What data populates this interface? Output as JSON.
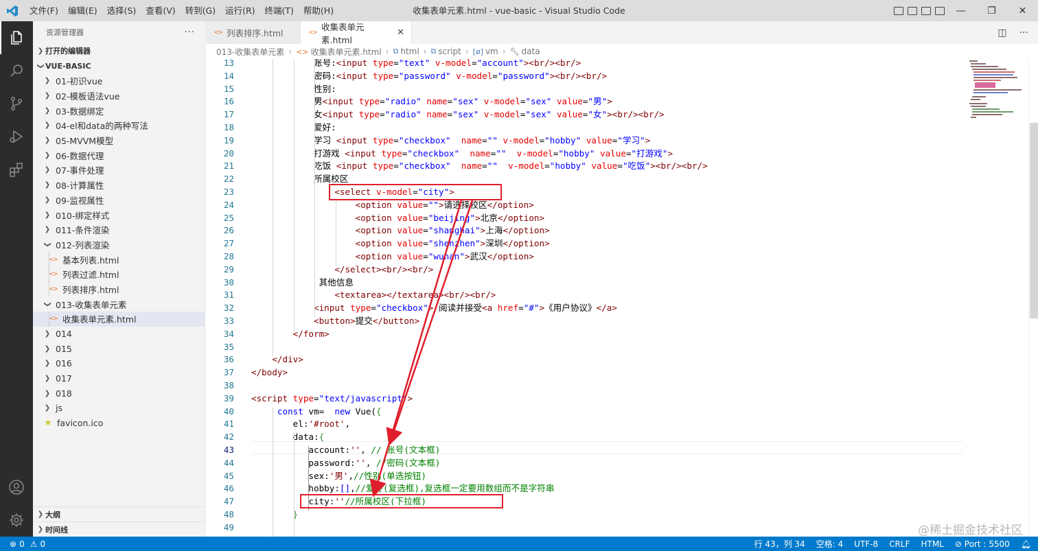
{
  "titlebar": {
    "menu": [
      "文件(F)",
      "编辑(E)",
      "选择(S)",
      "查看(V)",
      "转到(G)",
      "运行(R)",
      "终端(T)",
      "帮助(H)"
    ],
    "window_title": "收集表单元素.html - vue-basic - Visual Studio Code"
  },
  "activity": [
    "explorer-icon",
    "search-icon",
    "source-control-icon",
    "run-debug-icon",
    "extensions-icon",
    "account-icon",
    "settings-gear-icon"
  ],
  "sidebar": {
    "title": "资源管理器",
    "more": "···",
    "open_editors": "打开的编辑器",
    "project": "VUE-BASIC",
    "items": [
      {
        "label": "01-初识vue",
        "type": "folder"
      },
      {
        "label": "02-模板语法vue",
        "type": "folder"
      },
      {
        "label": "03-数据绑定",
        "type": "folder"
      },
      {
        "label": "04-el和data的两种写法",
        "type": "folder"
      },
      {
        "label": "05-MVVM模型",
        "type": "folder"
      },
      {
        "label": "06-数据代理",
        "type": "folder"
      },
      {
        "label": "07-事件处理",
        "type": "folder"
      },
      {
        "label": "08-计算属性",
        "type": "folder"
      },
      {
        "label": "09-监视属性",
        "type": "folder"
      },
      {
        "label": "010-绑定样式",
        "type": "folder"
      },
      {
        "label": "011-条件渲染",
        "type": "folder"
      },
      {
        "label": "012-列表渲染",
        "type": "open-folder"
      },
      {
        "label": "基本列表.html",
        "type": "file"
      },
      {
        "label": "列表过滤.html",
        "type": "file"
      },
      {
        "label": "列表排序.html",
        "type": "file"
      },
      {
        "label": "013-收集表单元素",
        "type": "open-folder"
      },
      {
        "label": "收集表单元素.html",
        "type": "file",
        "selected": true
      },
      {
        "label": "014",
        "type": "folder"
      },
      {
        "label": "015",
        "type": "folder"
      },
      {
        "label": "016",
        "type": "folder"
      },
      {
        "label": "017",
        "type": "folder"
      },
      {
        "label": "018",
        "type": "folder"
      },
      {
        "label": "js",
        "type": "folder"
      },
      {
        "label": "favicon.ico",
        "type": "star"
      }
    ],
    "outline": "大纲",
    "timeline": "时间线"
  },
  "tabs": [
    {
      "label": "列表排序.html",
      "active": false
    },
    {
      "label": "收集表单元素.html",
      "active": true
    }
  ],
  "tab_close": "✕",
  "breadcrumbs": [
    "013-收集表单元素",
    "收集表单元素.html",
    "html",
    "script",
    "vm",
    "data"
  ],
  "editor": {
    "lines": [
      {
        "n": "13",
        "html": "<span class=\"p\">            账号:</span><span class=\"t\">&lt;input</span> <span class=\"a\">type</span>=<span class=\"s\">\"text\"</span> <span class=\"a\">v-model</span>=<span class=\"s\">\"account\"</span><span class=\"t\">&gt;&lt;br/&gt;&lt;br/&gt;</span>"
      },
      {
        "n": "14",
        "html": "<span class=\"p\">            密码:</span><span class=\"t\">&lt;input</span> <span class=\"a\">type</span>=<span class=\"s\">\"password\"</span> <span class=\"a\">v-model</span>=<span class=\"s\">\"password\"</span><span class=\"t\">&gt;&lt;br/&gt;&lt;br/&gt;</span>"
      },
      {
        "n": "15",
        "html": "<span class=\"p\">            性别:</span>"
      },
      {
        "n": "16",
        "html": "<span class=\"p\">            男</span><span class=\"t\">&lt;input</span> <span class=\"a\">type</span>=<span class=\"s\">\"radio\"</span> <span class=\"a\">name</span>=<span class=\"s\">\"sex\"</span> <span class=\"a\">v-model</span>=<span class=\"s\">\"sex\"</span> <span class=\"a\">value</span>=<span class=\"s\">\"男\"</span><span class=\"t\">&gt;</span>"
      },
      {
        "n": "17",
        "html": "<span class=\"p\">            女</span><span class=\"t\">&lt;input</span> <span class=\"a\">type</span>=<span class=\"s\">\"radio\"</span> <span class=\"a\">name</span>=<span class=\"s\">\"sex\"</span> <span class=\"a\">v-model</span>=<span class=\"s\">\"sex\"</span> <span class=\"a\">value</span>=<span class=\"s\">\"女\"</span><span class=\"t\">&gt;&lt;br/&gt;&lt;br/&gt;</span>"
      },
      {
        "n": "18",
        "html": "<span class=\"p\">            爱好:</span>"
      },
      {
        "n": "19",
        "html": "<span class=\"p\">            学习 </span><span class=\"t\">&lt;input</span> <span class=\"a\">type</span>=<span class=\"s\">\"checkbox\"</span>  <span class=\"a\">name</span>=<span class=\"s\">\"\"</span> <span class=\"a\">v-model</span>=<span class=\"s\">\"hobby\"</span> <span class=\"a\">value</span>=<span class=\"s\">\"学习\"</span><span class=\"t\">&gt;</span>"
      },
      {
        "n": "20",
        "html": "<span class=\"p\">            打游戏 </span><span class=\"t\">&lt;input</span> <span class=\"a\">type</span>=<span class=\"s\">\"checkbox\"</span>  <span class=\"a\">name</span>=<span class=\"s\">\"\"</span>  <span class=\"a\">v-model</span>=<span class=\"s\">\"hobby\"</span> <span class=\"a\">value</span>=<span class=\"s\">\"打游戏\"</span><span class=\"t\">&gt;</span>"
      },
      {
        "n": "21",
        "html": "<span class=\"p\">            吃饭 </span><span class=\"t\">&lt;input</span> <span class=\"a\">type</span>=<span class=\"s\">\"checkbox\"</span>  <span class=\"a\">name</span>=<span class=\"s\">\"\"</span>  <span class=\"a\">v-model</span>=<span class=\"s\">\"hobby\"</span> <span class=\"a\">value</span>=<span class=\"s\">\"吃饭\"</span><span class=\"t\">&gt;&lt;br/&gt;&lt;br/&gt;</span>"
      },
      {
        "n": "22",
        "html": "<span class=\"p\">            所属校区</span>"
      },
      {
        "n": "23",
        "html": "<span class=\"t\">                &lt;select</span> <span class=\"a\">v-model</span>=<span class=\"s\">\"city\"</span><span class=\"t\">&gt;</span>"
      },
      {
        "n": "24",
        "html": "<span class=\"t\">                    &lt;option</span> <span class=\"a\">value</span>=<span class=\"s\">\"\"</span><span class=\"t\">&gt;</span><span class=\"p\">请选择校区</span><span class=\"t\">&lt;/option&gt;</span>"
      },
      {
        "n": "25",
        "html": "<span class=\"t\">                    &lt;option</span> <span class=\"a\">value</span>=<span class=\"s\">\"beijing\"</span><span class=\"t\">&gt;</span><span class=\"p\">北京</span><span class=\"t\">&lt;/option&gt;</span>"
      },
      {
        "n": "26",
        "html": "<span class=\"t\">                    &lt;option</span> <span class=\"a\">value</span>=<span class=\"s\">\"shanghai\"</span><span class=\"t\">&gt;</span><span class=\"p\">上海</span><span class=\"t\">&lt;/option&gt;</span>"
      },
      {
        "n": "27",
        "html": "<span class=\"t\">                    &lt;option</span> <span class=\"a\">value</span>=<span class=\"s\">\"shenzhen\"</span><span class=\"t\">&gt;</span><span class=\"p\">深圳</span><span class=\"t\">&lt;/option&gt;</span>"
      },
      {
        "n": "28",
        "html": "<span class=\"t\">                    &lt;option</span> <span class=\"a\">value</span>=<span class=\"s\">\"wuhan\"</span><span class=\"t\">&gt;</span><span class=\"p\">武汉</span><span class=\"t\">&lt;/option&gt;</span>"
      },
      {
        "n": "29",
        "html": "<span class=\"t\">                &lt;/select&gt;&lt;br/&gt;&lt;br/&gt;</span>"
      },
      {
        "n": "30",
        "html": "<span class=\"p\">             其他信息</span>"
      },
      {
        "n": "31",
        "html": "<span class=\"t\">                &lt;textarea&gt;&lt;/textarea&gt;&lt;br/&gt;&lt;br/&gt;</span>"
      },
      {
        "n": "32",
        "html": "<span class=\"t\">            &lt;input</span> <span class=\"a\">type</span>=<span class=\"s\">\"checkbox\"</span><span class=\"t\">&gt;</span><span class=\"p\"> 阅读并接受</span><span class=\"t\">&lt;a</span> <span class=\"a\">href</span>=<span class=\"s\">\"#\"</span><span class=\"t\">&gt;</span><span class=\"p\">《用户协议》</span><span class=\"t\">&lt;/a&gt;</span>"
      },
      {
        "n": "33",
        "html": "<span class=\"t\">            &lt;button&gt;</span><span class=\"p\">提交</span><span class=\"t\">&lt;/button&gt;</span>"
      },
      {
        "n": "34",
        "html": "<span class=\"t\">        &lt;/form&gt;</span>"
      },
      {
        "n": "35",
        "html": ""
      },
      {
        "n": "36",
        "html": "<span class=\"t\">    &lt;/div&gt;</span>"
      },
      {
        "n": "37",
        "html": "<span class=\"t\">&lt;/body&gt;</span>"
      },
      {
        "n": "38",
        "html": ""
      },
      {
        "n": "39",
        "html": "<span class=\"t\">&lt;script</span> <span class=\"a\">type</span>=<span class=\"s\">\"text/javascript\"</span><span class=\"t\">&gt;</span>"
      },
      {
        "n": "40",
        "html": "<span class=\"p\">     </span><span class=\"k\">const</span><span class=\"p\"> vm=  </span><span class=\"k\">new</span><span class=\"p\"> Vue(</span><span class=\"br\">{</span>"
      },
      {
        "n": "41",
        "html": "<span class=\"p\">        el:</span><span class=\"t\">'#root'</span><span class=\"p\">,</span>"
      },
      {
        "n": "42",
        "html": "<span class=\"p\">        data:</span><span class=\"br\">{</span>"
      },
      {
        "n": "43",
        "html": "<span class=\"p\">           account:</span><span class=\"t\">''</span><span class=\"p\">, </span><span class=\"cm\">// 账号(文本框)</span>",
        "cur": true
      },
      {
        "n": "44",
        "html": "<span class=\"p\">           password:</span><span class=\"t\">''</span><span class=\"p\">, </span><span class=\"cm\">//密码(文本框)</span>"
      },
      {
        "n": "45",
        "html": "<span class=\"p\">           sex:</span><span class=\"t\">'男'</span><span class=\"p\">,</span><span class=\"cm\">//性别(单选按钮)</span>"
      },
      {
        "n": "46",
        "html": "<span class=\"p\">           hobby:</span><span class=\"k\">[]</span><span class=\"p\">,</span><span class=\"cm\">//爱好(复选框),复选框一定要用数组而不是字符串</span>"
      },
      {
        "n": "47",
        "html": "<span class=\"p\">           city:</span><span class=\"t\">''</span><span class=\"cm\">//所属校区(下拉框)</span>"
      },
      {
        "n": "48",
        "html": "<span class=\"br\">        }</span>"
      },
      {
        "n": "49",
        "html": ""
      }
    ]
  },
  "statusbar": {
    "errors": "0",
    "warnings": "0",
    "position": "行 43，列 34",
    "spaces": "空格: 4",
    "encoding": "UTF-8",
    "eol": "CRLF",
    "language": "HTML",
    "port": "Port : 5500"
  },
  "watermark": "@稀土掘金技术社区",
  "colors": {
    "statusbar": "#007acc",
    "activitybar": "#2c2c2c",
    "highlight": "#e01e2b"
  }
}
